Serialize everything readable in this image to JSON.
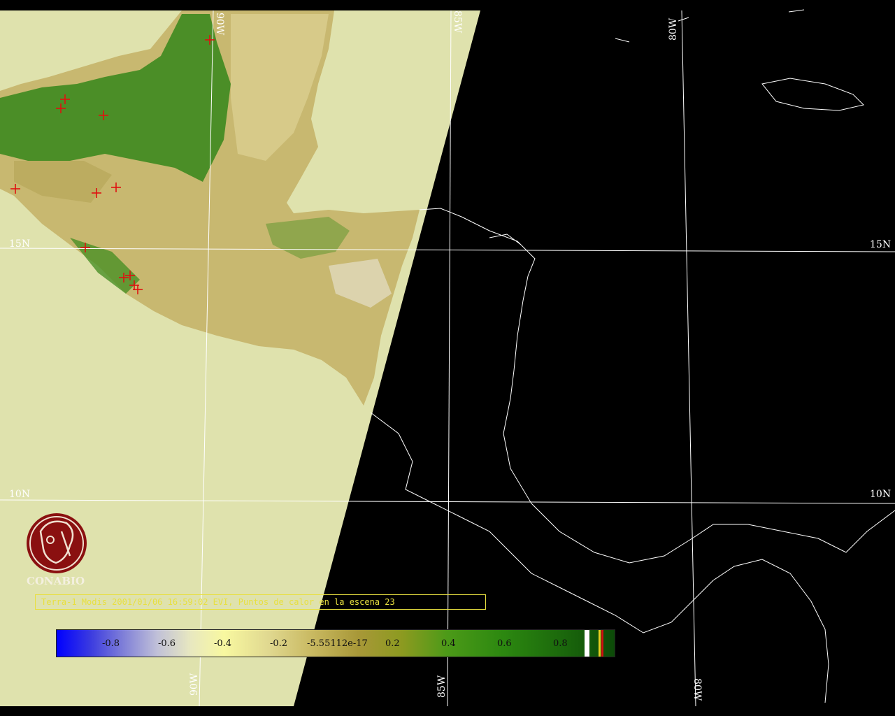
{
  "map": {
    "lat_labels": [
      "15N",
      "15N",
      "10N",
      "10N"
    ],
    "lon_labels": [
      "90W",
      "85W",
      "80W",
      "90W",
      "85W",
      "80W"
    ],
    "colors": {
      "no_data": "#dfe2ad",
      "land_green": "#3a8a1c",
      "land_tan": "#c8b870",
      "grid": "#ffffff",
      "coast": "#ffffff",
      "hotspot": "#e01010"
    },
    "hotspot_icon": "red-cross-marker"
  },
  "logo": {
    "text": "CONABIO",
    "icon": "conabio-emblem"
  },
  "caption": {
    "text": "Terra-1 Modis 2001/01/06 16:59:02 EVI, Puntos de calor en la escena 23"
  },
  "colorbar": {
    "ticks": [
      "-0.8",
      "-0.6",
      "-0.4",
      "-0.2",
      "-5.55112e-17",
      "0.2",
      "0.4",
      "0.6",
      "0.8"
    ]
  }
}
